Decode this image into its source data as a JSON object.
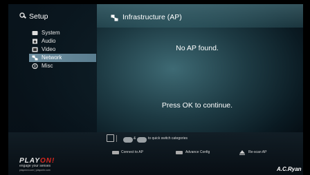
{
  "sidebar": {
    "title": "Setup",
    "items": [
      {
        "label": "System",
        "icon": "system-icon",
        "selected": false
      },
      {
        "label": "Audio",
        "icon": "audio-icon",
        "selected": false
      },
      {
        "label": "Video",
        "icon": "video-icon",
        "selected": false
      },
      {
        "label": "Network",
        "icon": "network-icon",
        "selected": true
      },
      {
        "label": "Misc",
        "icon": "misc-icon",
        "selected": false
      }
    ]
  },
  "header": {
    "title": "Infrastructure (AP)"
  },
  "main": {
    "message": "No AP found.",
    "prompt": "Press OK to continue."
  },
  "footer": {
    "quick_switch": {
      "amp": "&",
      "text": "to quick switch categories"
    },
    "actions": [
      {
        "label": "Connect to AP",
        "icon": "connect-icon"
      },
      {
        "label": "Advance Config",
        "icon": "config-icon"
      },
      {
        "label": "Re-scan AP",
        "icon": "rescan-icon"
      }
    ],
    "logo": {
      "part1": "PLAY",
      "part2": "ON!"
    },
    "tagline": "engage your senses",
    "urls": "playonrd.com | playonhr.com",
    "brand": "A.C.Ryan"
  },
  "colors": {
    "accent_red": "#d8281f",
    "selected_bg": "#6e8fa0"
  }
}
